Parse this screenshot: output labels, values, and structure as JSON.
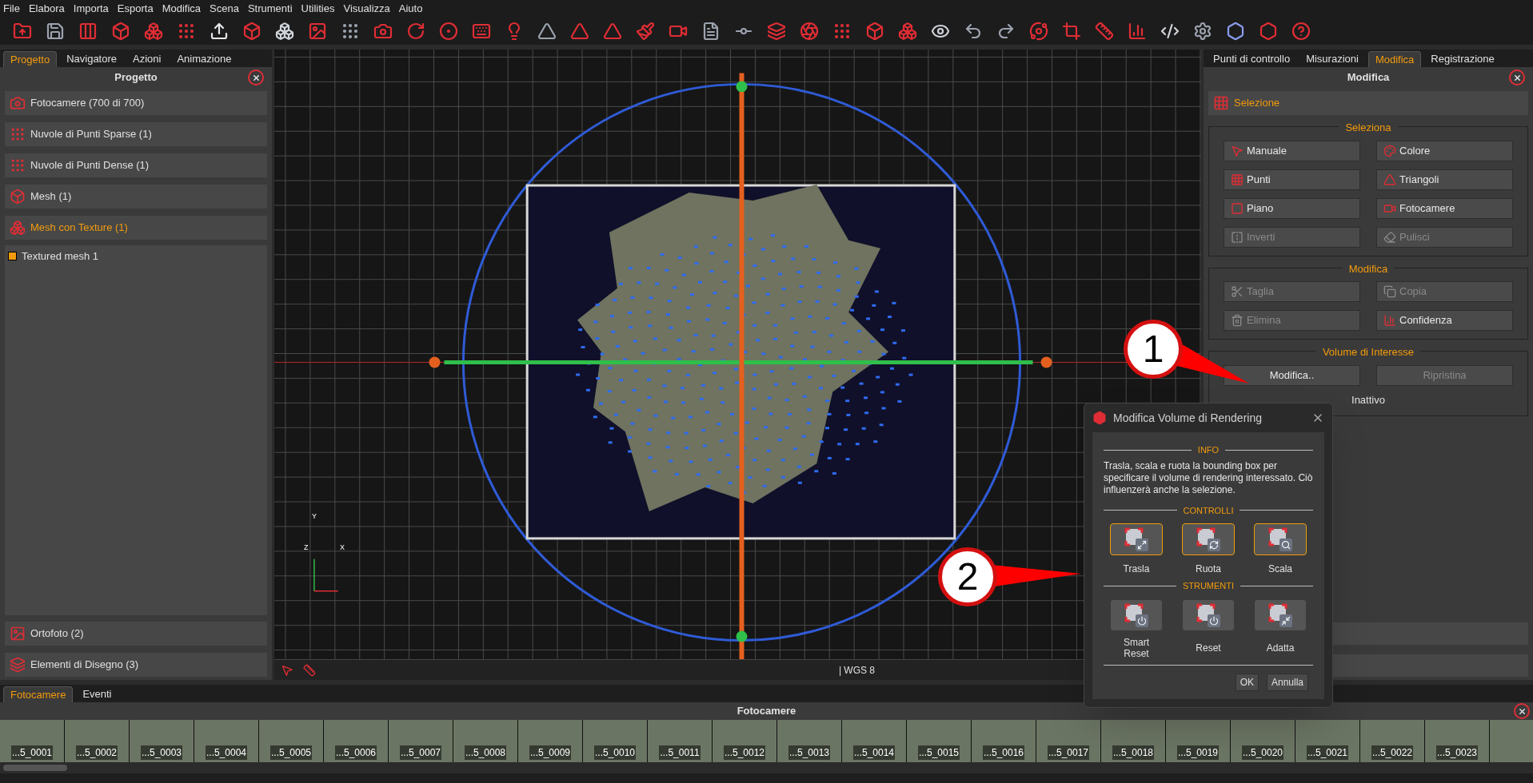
{
  "menu": [
    "File",
    "Elabora",
    "Importa",
    "Esporta",
    "Modifica",
    "Scena",
    "Strumenti",
    "Utilities",
    "Visualizza",
    "Aiuto"
  ],
  "left_panel": {
    "tabs": [
      {
        "label": "Progetto",
        "selected": true
      },
      {
        "label": "Navigatore",
        "selected": false
      },
      {
        "label": "Azioni",
        "selected": false
      },
      {
        "label": "Animazione",
        "selected": false
      }
    ],
    "title": "Progetto",
    "items": [
      {
        "label": "Fotocamere (700 di 700)",
        "selected": false
      },
      {
        "label": "Nuvole di Punti Sparse (1)",
        "selected": false
      },
      {
        "label": "Nuvole di Punti Dense (1)",
        "selected": false
      },
      {
        "label": "Mesh (1)",
        "selected": false
      },
      {
        "label": "Mesh con Texture (1)",
        "selected": true
      }
    ],
    "tree": [
      {
        "label": "Textured mesh 1",
        "color": "#f29b0c"
      }
    ],
    "bottom_items": [
      {
        "label": "Ortofoto (2)"
      },
      {
        "label": "Elementi di Disegno (3)"
      }
    ]
  },
  "viewport": {
    "axis_y": "Y",
    "axis_z": "Z",
    "axis_x": "X",
    "status": "| WGS 8"
  },
  "right_panel": {
    "tabs": [
      {
        "label": "Punti di controllo",
        "selected": false
      },
      {
        "label": "Misurazioni",
        "selected": false
      },
      {
        "label": "Modifica",
        "selected": true
      },
      {
        "label": "Registrazione",
        "selected": false
      }
    ],
    "title": "Modifica",
    "section": "Selezione",
    "groups": [
      {
        "title": "Seleziona",
        "buttons": [
          {
            "label": "Manuale",
            "disabled": false
          },
          {
            "label": "Colore",
            "disabled": false
          },
          {
            "label": "Punti",
            "disabled": false
          },
          {
            "label": "Triangoli",
            "disabled": false
          },
          {
            "label": "Piano",
            "disabled": false
          },
          {
            "label": "Fotocamere",
            "disabled": false
          },
          {
            "label": "Inverti",
            "disabled": true
          },
          {
            "label": "Pulisci",
            "disabled": true
          }
        ]
      },
      {
        "title": "Modifica",
        "buttons": [
          {
            "label": "Taglia",
            "disabled": true
          },
          {
            "label": "Copia",
            "disabled": true
          },
          {
            "label": "Elimina",
            "disabled": true
          },
          {
            "label": "Confidenza",
            "disabled": false
          }
        ]
      },
      {
        "title": "Volume di Interesse",
        "buttons": [
          {
            "label": "Modifica..",
            "disabled": false
          },
          {
            "label": "Ripristina",
            "disabled": true
          }
        ],
        "status": "Inattivo"
      }
    ]
  },
  "dialog": {
    "title": "Modifica Volume di Rendering",
    "info_heading": "INFO",
    "info": "Trasla, scala e ruota la bounding box per specificare il volume di rendering interessato. Ciò influenzerà anche la selezione.",
    "controls_heading": "CONTROLLI",
    "controls": [
      {
        "label": "Trasla",
        "selected": true
      },
      {
        "label": "Ruota",
        "selected": true
      },
      {
        "label": "Scala",
        "selected": true
      }
    ],
    "tools_heading": "STRUMENTI",
    "tools": [
      {
        "label": "Smart Reset"
      },
      {
        "label": "Reset"
      },
      {
        "label": "Adatta"
      }
    ],
    "buttons": [
      "OK",
      "Annulla"
    ]
  },
  "bottom": {
    "tabs": [
      {
        "label": "Fotocamere",
        "selected": true
      },
      {
        "label": "Eventi",
        "selected": false
      }
    ],
    "title": "Fotocamere",
    "thumbnails": [
      "...5_0001",
      "...5_0002",
      "...5_0003",
      "...5_0004",
      "...5_0005",
      "...5_0006",
      "...5_0007",
      "...5_0008",
      "...5_0009",
      "...5_0010",
      "...5_0011",
      "...5_0012",
      "...5_0013",
      "...5_0014",
      "...5_0015",
      "...5_0016",
      "...5_0017",
      "...5_0018",
      "...5_0019",
      "...5_0020",
      "...5_0021",
      "...5_0022",
      "...5_0023"
    ]
  },
  "callouts": [
    "1",
    "2"
  ]
}
